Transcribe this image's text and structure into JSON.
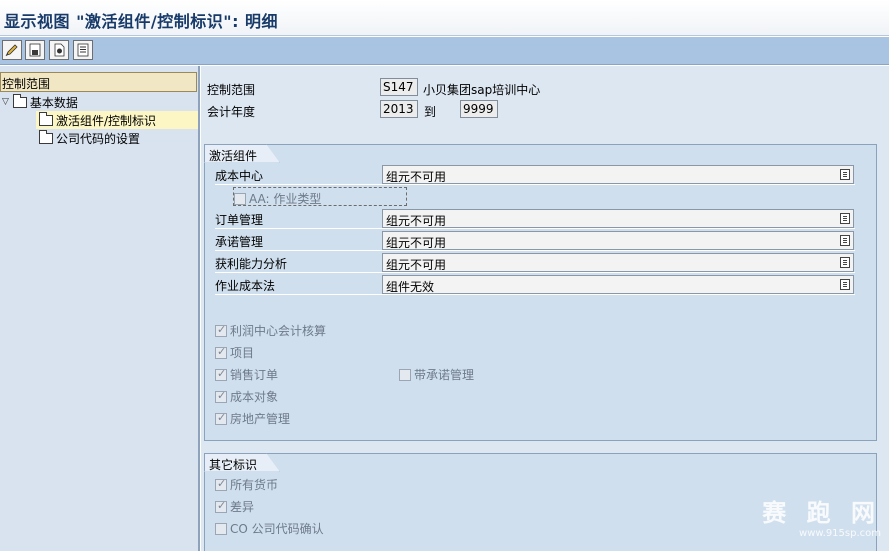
{
  "window": {
    "title": "显示视图 \"激活组件/控制标识\": 明细"
  },
  "toolbar": {
    "buttons": [
      "edit-icon",
      "save-icon",
      "new-entry-icon",
      "copy-icon"
    ]
  },
  "nav": {
    "header": "控制范围",
    "items": [
      {
        "label": "基本数据",
        "icon": "folder-icon",
        "expanded": true
      },
      {
        "label": "激活组件/控制标识",
        "icon": "folder-icon",
        "selected": true
      },
      {
        "label": "公司代码的设置",
        "icon": "folder-icon"
      }
    ]
  },
  "header": {
    "controlling_area_label": "控制范围",
    "controlling_area_value": "S147",
    "controlling_area_name": "小贝集团sap培训中心",
    "fiscal_year_label": "会计年度",
    "fiscal_year_from": "2013",
    "fiscal_year_to_label": "到",
    "fiscal_year_to": "9999"
  },
  "active_components": {
    "title": "激活组件",
    "rows": [
      {
        "label": "成本中心",
        "value": "组元不可用"
      },
      {
        "label": "订单管理",
        "value": "组元不可用"
      },
      {
        "label": "承诺管理",
        "value": "组元不可用"
      },
      {
        "label": "获利能力分析",
        "value": "组元不可用"
      },
      {
        "label": "作业成本法",
        "value": "组件无效"
      }
    ],
    "aa_activity_type": {
      "label": "AA: 作业类型",
      "checked": false
    },
    "checkboxes": [
      {
        "label": "利润中心会计核算",
        "checked": true
      },
      {
        "label": "项目",
        "checked": true
      },
      {
        "label": "销售订单",
        "checked": true
      },
      {
        "label": "成本对象",
        "checked": true
      },
      {
        "label": "房地产管理",
        "checked": true
      }
    ],
    "commitment_mgmt": {
      "label": "带承诺管理",
      "checked": false
    }
  },
  "other_indicators": {
    "title": "其它标识",
    "checkboxes": [
      {
        "label": "所有货币",
        "checked": true
      },
      {
        "label": "差异",
        "checked": true
      },
      {
        "label": "CO 公司代码确认",
        "checked": false
      }
    ]
  },
  "watermark": {
    "text": "赛 跑 网",
    "url": "www.915sp.com"
  }
}
